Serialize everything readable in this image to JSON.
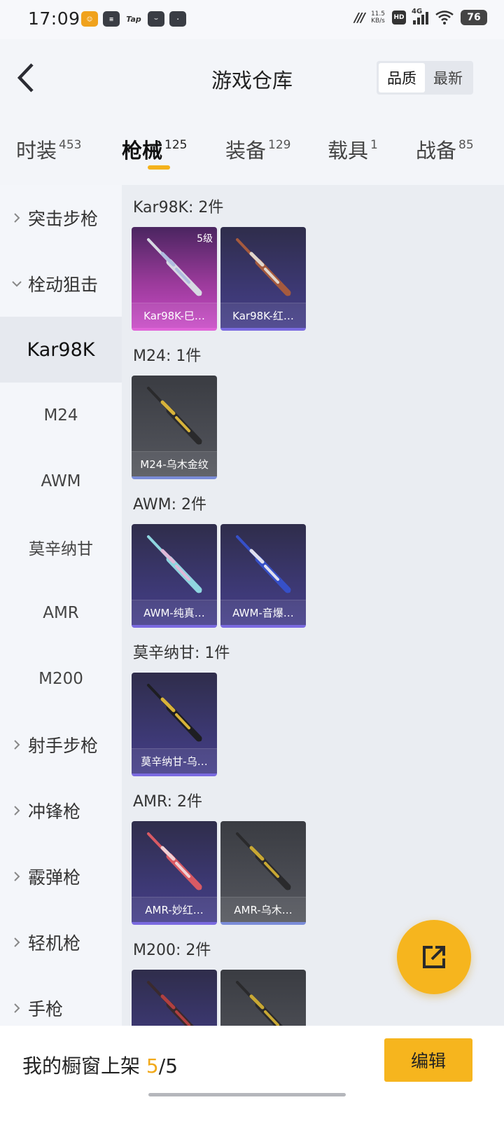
{
  "status_bar": {
    "time": "17:09",
    "tap_label": "Tap",
    "net_speed_value": "11.5",
    "net_speed_unit": "KB/s",
    "hd_label": "HD",
    "network_label": "4G",
    "battery": "76"
  },
  "header": {
    "title": "游戏仓库",
    "sort_options": [
      "品质",
      "最新"
    ]
  },
  "tabs": [
    {
      "label": "时装",
      "count": "453"
    },
    {
      "label": "枪械",
      "count": "125"
    },
    {
      "label": "装备",
      "count": "129"
    },
    {
      "label": "载具",
      "count": "1"
    },
    {
      "label": "战备",
      "count": "85"
    }
  ],
  "sidebar": {
    "categories": [
      {
        "label": "突击步枪"
      },
      {
        "label": "栓动狙击"
      },
      {
        "label": "射手步枪"
      },
      {
        "label": "冲锋枪"
      },
      {
        "label": "霰弹枪"
      },
      {
        "label": "轻机枪"
      },
      {
        "label": "手枪"
      }
    ],
    "subitems": [
      "Kar98K",
      "M24",
      "AWM",
      "莫辛纳甘",
      "AMR",
      "M200"
    ]
  },
  "groups": [
    {
      "title": "Kar98K: 2件",
      "items": [
        {
          "name": "Kar98K-巳…",
          "level": "5级",
          "style": "pink",
          "gun_color": "#d7d9e3",
          "accent": "#b0bde0"
        },
        {
          "name": "Kar98K-红…",
          "level": "",
          "style": "purple",
          "gun_color": "#a55a3e",
          "accent": "#e0d6cc"
        }
      ]
    },
    {
      "title": "M24: 1件",
      "items": [
        {
          "name": "M24-乌木金纹",
          "level": "",
          "style": "grey",
          "gun_color": "#2a2a2c",
          "accent": "#d8b33a"
        }
      ]
    },
    {
      "title": "AWM: 2件",
      "items": [
        {
          "name": "AWM-纯真…",
          "level": "",
          "style": "purple",
          "gun_color": "#8fd6e0",
          "accent": "#e0b8d8"
        },
        {
          "name": "AWM-音爆…",
          "level": "",
          "style": "purple",
          "gun_color": "#3650c8",
          "accent": "#e0e0ee"
        }
      ]
    },
    {
      "title": "莫辛纳甘: 1件",
      "items": [
        {
          "name": "莫辛纳甘-乌…",
          "level": "",
          "style": "purple",
          "gun_color": "#1e1e22",
          "accent": "#d8b33a"
        }
      ]
    },
    {
      "title": "AMR: 2件",
      "items": [
        {
          "name": "AMR-妙红…",
          "level": "",
          "style": "purple",
          "gun_color": "#d85a64",
          "accent": "#f0d0d4"
        },
        {
          "name": "AMR-乌木…",
          "level": "",
          "style": "grey",
          "gun_color": "#2a2a2c",
          "accent": "#c8a834"
        }
      ]
    },
    {
      "title": "M200: 2件",
      "items": [
        {
          "name": "",
          "level": "",
          "style": "purple",
          "gun_color": "#3a2a2e",
          "accent": "#b04040"
        },
        {
          "name": "",
          "level": "",
          "style": "grey",
          "gun_color": "#2a2a2c",
          "accent": "#c8a834"
        }
      ]
    }
  ],
  "footer": {
    "label": "我的橱窗上架",
    "count_current": "5",
    "count_separator": "/",
    "count_total": "5",
    "edit_label": "编辑"
  },
  "colors": {
    "accent": "#f6b51e",
    "highlight_text": "#f1a91a"
  }
}
